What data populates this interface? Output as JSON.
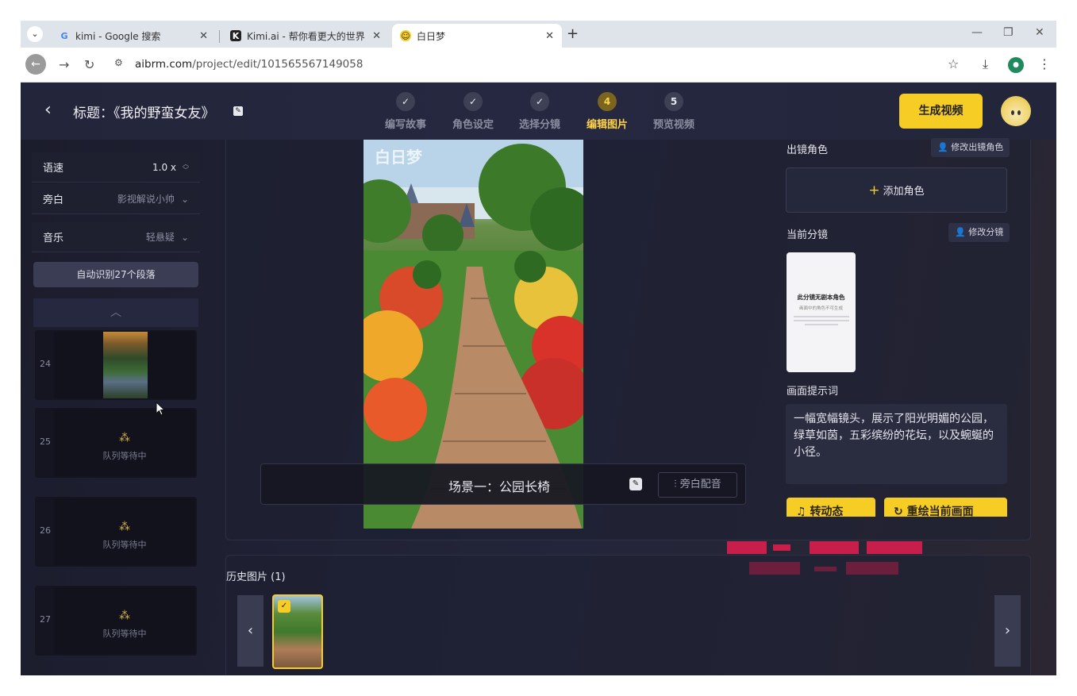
{
  "browser": {
    "tabs": [
      {
        "favicon": "G",
        "title": "kimi - Google 搜索"
      },
      {
        "favicon": "K",
        "title": "Kimi.ai - 帮你看更大的世界"
      },
      {
        "favicon": "☺",
        "title": "白日梦"
      }
    ],
    "url_host": "aibrm.com",
    "url_path": "/project/edit/101565567149058"
  },
  "header": {
    "title": "标题：《我的野蛮女友》",
    "steps": [
      {
        "num": "✓",
        "label": "编写故事"
      },
      {
        "num": "✓",
        "label": "角色设定"
      },
      {
        "num": "✓",
        "label": "选择分镜"
      },
      {
        "num": "4",
        "label": "编辑图片"
      },
      {
        "num": "5",
        "label": "预览视频"
      }
    ],
    "generate_label": "生成视频"
  },
  "sidebar": {
    "speed_label": "语速",
    "speed_value": "1.0 x",
    "narration_label": "旁白",
    "narration_value": "影视解说小帅",
    "music_label": "音乐",
    "music_value": "轻悬疑",
    "auto_label": "自动识别27个段落",
    "segments": [
      {
        "num": "24",
        "status": ""
      },
      {
        "num": "25",
        "status": "队列等待中"
      },
      {
        "num": "26",
        "status": "队列等待中"
      },
      {
        "num": "27",
        "status": "队列等待中"
      }
    ]
  },
  "editor": {
    "scene_title": "场景一：公园长椅",
    "voice_label": "旁白配音",
    "watermark": "白日梦"
  },
  "right": {
    "roles_label": "出镜角色",
    "edit_roles_label": "修改出镜角色",
    "add_role_label": "添加角色",
    "current_shot_label": "当前分镜",
    "edit_shot_label": "修改分镜",
    "shot_card_title": "此分镜无剧本角色",
    "shot_card_sub": "画面中的角色不可生成",
    "prompt_label": "画面提示词",
    "prompt_text": "一幅宽幅镜头，展示了阳光明媚的公园，绿草如茵，五彩缤纷的花坛，以及蜿蜒的小径。",
    "btn_animate": "转动态",
    "btn_regen": "重绘当前画面"
  },
  "history": {
    "title": "历史图片 (1)"
  }
}
